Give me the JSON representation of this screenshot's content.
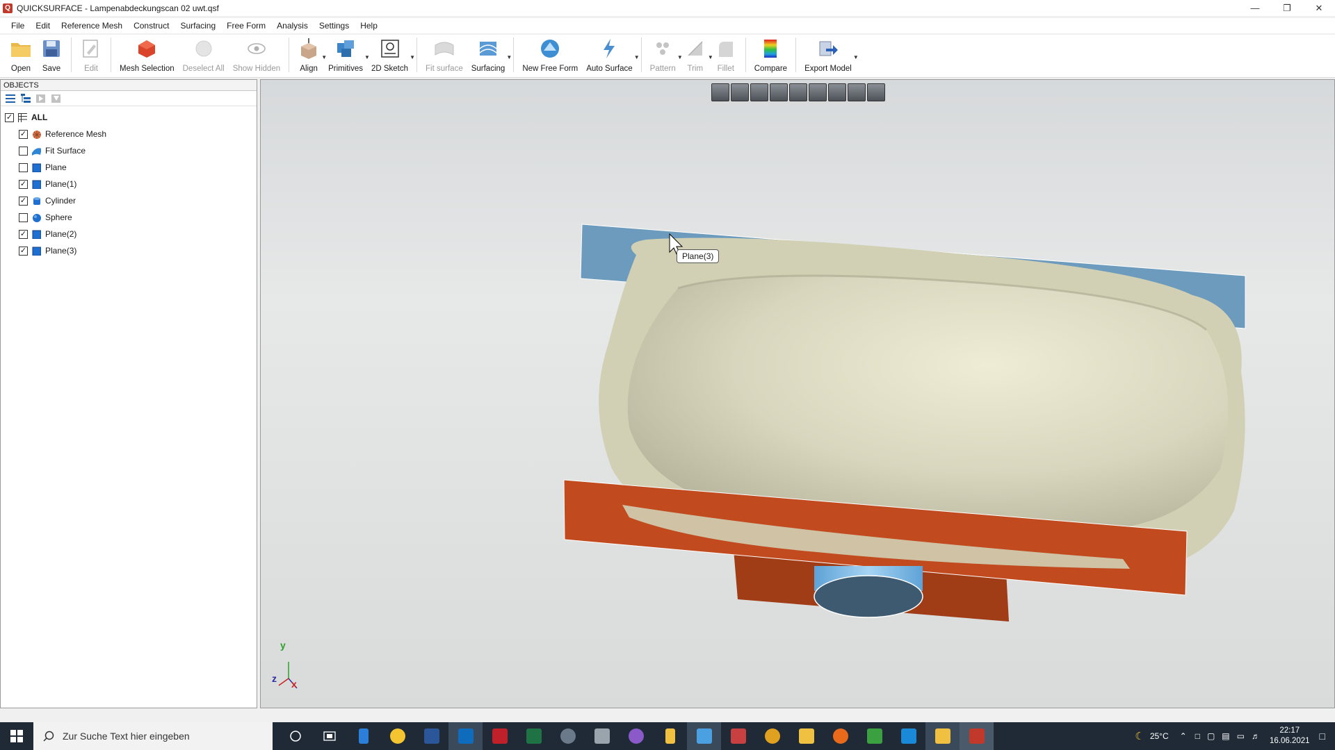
{
  "window": {
    "title": "QUICKSURFACE - Lampenabdeckungscan 02 uwt.qsf",
    "app_icon": "quicksurface-logo-icon",
    "controls": [
      "minimize-icon",
      "restore-icon",
      "close-icon"
    ]
  },
  "menu": [
    "File",
    "Edit",
    "Reference Mesh",
    "Construct",
    "Surfacing",
    "Free Form",
    "Analysis",
    "Settings",
    "Help"
  ],
  "toolbar": {
    "open": "Open",
    "save": "Save",
    "edit": "Edit",
    "mesh_selection": "Mesh Selection",
    "deselect_all": "Deselect All",
    "show_hidden": "Show Hidden",
    "align": "Align",
    "primitives": "Primitives",
    "sketch_2d": "2D Sketch",
    "fit_surface": "Fit surface",
    "surfacing": "Surfacing",
    "new_free_form": "New Free Form",
    "auto_surface": "Auto Surface",
    "pattern": "Pattern",
    "trim": "Trim",
    "fillet": "Fillet",
    "compare": "Compare",
    "export_model": "Export Model"
  },
  "objects_panel": {
    "header": "OBJECTS",
    "root": {
      "label": "ALL",
      "checked": true
    },
    "items": [
      {
        "label": "Reference Mesh",
        "checked": true,
        "icon": "mesh-icon",
        "color": "#d9774e"
      },
      {
        "label": "Fit Surface",
        "checked": false,
        "icon": "surface-icon",
        "color": "#2f86d6"
      },
      {
        "label": "Plane",
        "checked": false,
        "icon": "plane-icon",
        "color": "#1f6fd1"
      },
      {
        "label": "Plane(1)",
        "checked": true,
        "icon": "plane-icon",
        "color": "#1f6fd1"
      },
      {
        "label": "Cylinder",
        "checked": true,
        "icon": "cylinder-icon",
        "color": "#1f6fd1"
      },
      {
        "label": "Sphere",
        "checked": false,
        "icon": "sphere-icon",
        "color": "#1f6fd1"
      },
      {
        "label": "Plane(2)",
        "checked": true,
        "icon": "plane-icon",
        "color": "#1f6fd1"
      },
      {
        "label": "Plane(3)",
        "checked": true,
        "icon": "plane-icon",
        "color": "#1f6fd1"
      }
    ]
  },
  "viewport": {
    "tooltip": "Plane(3)",
    "axis_labels": {
      "y": "y",
      "z": "z",
      "x": "x"
    },
    "colors": {
      "plane_blue": "#6d9bbd",
      "plane_orange": "#c14a1e",
      "mesh": "#d8d6bd",
      "cylinder": "#3e5a70"
    }
  },
  "taskbar": {
    "search_placeholder": "Zur Suche Text hier eingeben",
    "weather": "25°C",
    "time": "22:17",
    "date": "16.06.2021"
  }
}
